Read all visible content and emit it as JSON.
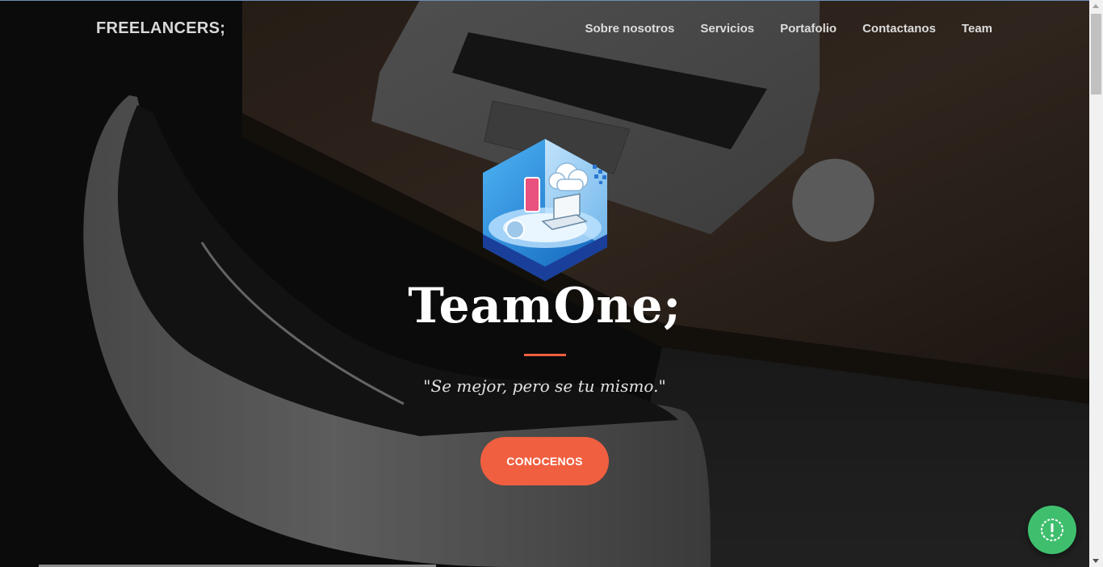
{
  "navbar": {
    "brand": "FREELANCERS;",
    "links": [
      {
        "label": "Sobre nosotros"
      },
      {
        "label": "Servicios"
      },
      {
        "label": "Portafolio"
      },
      {
        "label": "Contactanos"
      },
      {
        "label": "Team"
      }
    ]
  },
  "hero": {
    "title": "TeamOne;",
    "quote": "\"Se mejor, pero se tu mismo.\"",
    "cta_label": "CONOCENOS",
    "logo_icon": "cloud-devices-hexagon-icon"
  },
  "floating_button": {
    "icon": "alert-icon"
  },
  "colors": {
    "accent": "#f05f40",
    "float_button": "#3fbf6e",
    "title_text": "#ffffff",
    "nav_text": "#dcdcdc"
  }
}
